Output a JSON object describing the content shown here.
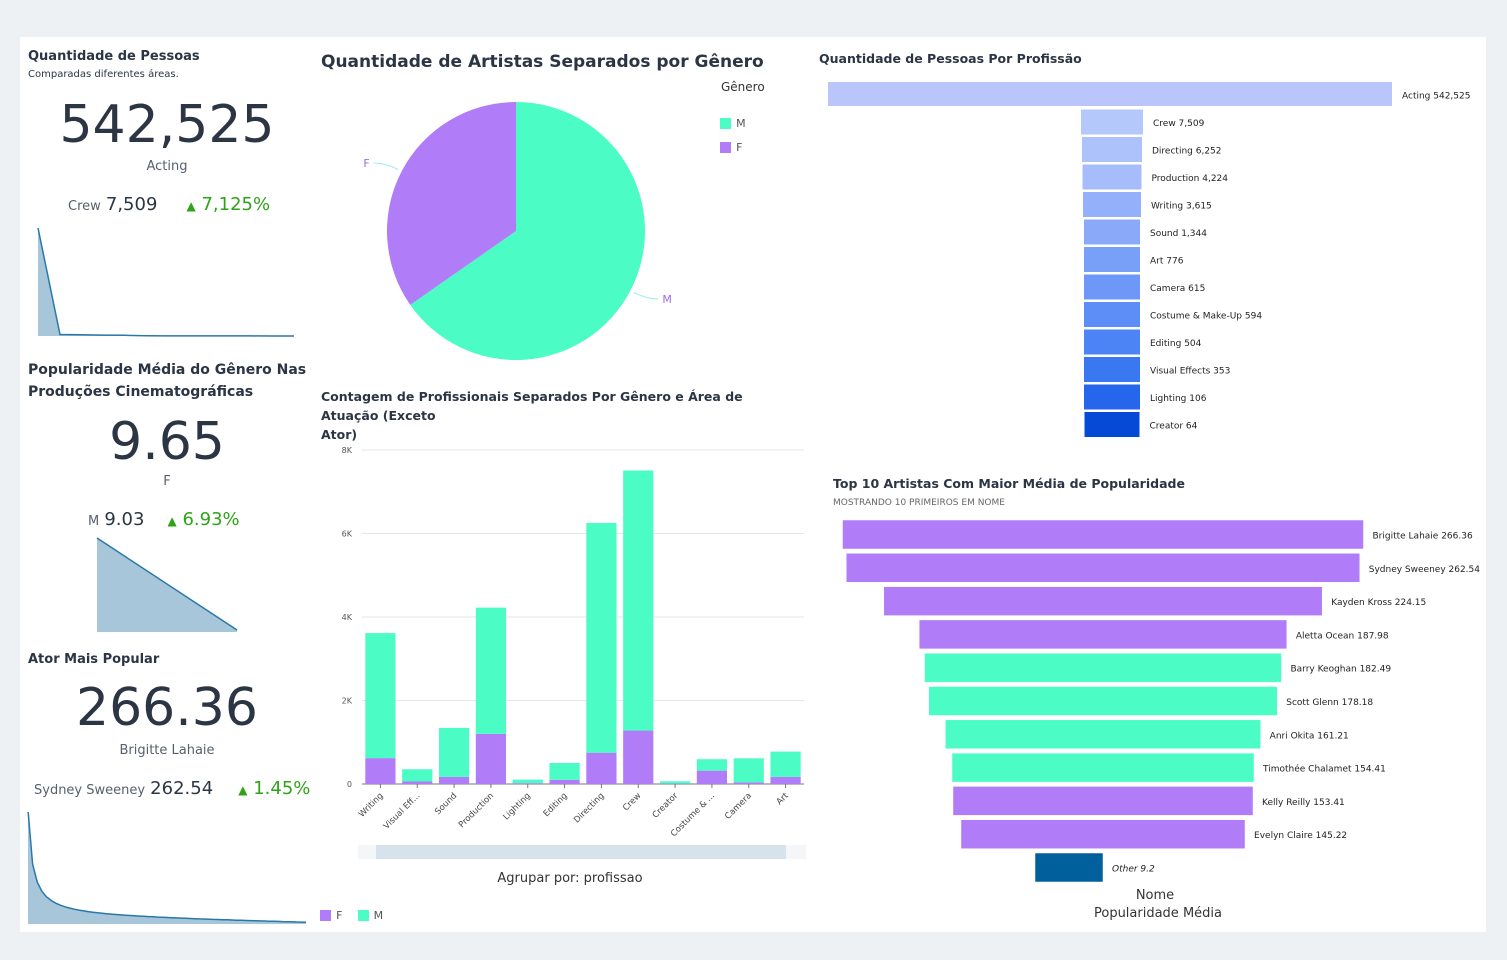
{
  "kpi1": {
    "title": "Quantidade de Pessoas",
    "subtitle": "Comparadas diferentes áreas.",
    "value": "542,525",
    "label": "Acting",
    "compare_label": "Crew",
    "compare_value": "7,509",
    "delta": "7,125%",
    "sparkline": [
      542525,
      7509,
      6252,
      4224,
      3615,
      1344,
      776,
      615,
      594,
      504,
      353,
      106,
      64
    ]
  },
  "kpi2": {
    "title_line1": "Popularidade Média do Gênero Nas",
    "title_line2": "Produções Cinematográficas",
    "value": "9.65",
    "label": "F",
    "compare_label": "M",
    "compare_value": "9.03",
    "delta": "6.93%",
    "sparkline": [
      9.65,
      9.03
    ]
  },
  "kpi3": {
    "title": "Ator Mais Popular",
    "value": "266.36",
    "label": "Brigitte Lahaie",
    "compare_label": "Sydney Sweeney",
    "compare_value": "262.54",
    "delta": "1.45%"
  },
  "colors": {
    "male": "#4cfcc5",
    "female": "#b07cf7",
    "sparkline_fill": "#a7c6da",
    "sparkline_line": "#2a78a8",
    "other_bar": "#00609c"
  },
  "chart_data": [
    {
      "type": "pie",
      "title": "Quantidade de Artistas Separados por Gênero",
      "legend_title": "Gênero",
      "legend_position": "top-right",
      "slices": [
        {
          "label": "M",
          "value": 65.3
        },
        {
          "label": "F",
          "value": 34.7
        }
      ]
    },
    {
      "type": "bar",
      "stacked": true,
      "title_line1": "Contagem de Profissionais Separados Por Gênero e Área de Atuação (Exceto",
      "title_line2": "Ator)",
      "categories": [
        "Writing",
        "Visual Eff...",
        "Sound",
        "Production",
        "Lighting",
        "Editing",
        "Directing",
        "Crew",
        "Creator",
        "Costume & ...",
        "Camera",
        "Art"
      ],
      "series": [
        {
          "name": "F",
          "values": [
            620,
            60,
            170,
            1200,
            20,
            100,
            750,
            1280,
            10,
            320,
            40,
            170
          ]
        },
        {
          "name": "M",
          "values": [
            2995,
            293,
            1174,
            3024,
            86,
            404,
            5502,
            6229,
            54,
            274,
            575,
            606
          ]
        }
      ],
      "yticks": [
        "0",
        "2K",
        "4K",
        "6K",
        "8K"
      ],
      "ylim": [
        0,
        8000
      ],
      "group_by_label": "Agrupar por: profissao",
      "legend_position": "bottom",
      "grid": true
    },
    {
      "type": "bar",
      "orientation": "funnel",
      "title": "Quantidade de Pessoas Por Profissão",
      "categories": [
        "Acting",
        "Crew",
        "Directing",
        "Production",
        "Writing",
        "Sound",
        "Art",
        "Camera",
        "Costume & Make-Up",
        "Editing",
        "Visual Effects",
        "Lighting",
        "Creator"
      ],
      "values": [
        542525,
        7509,
        6252,
        4224,
        3615,
        1344,
        776,
        615,
        594,
        504,
        353,
        106,
        64
      ],
      "labels": [
        "Acting 542,525",
        "Crew 7,509",
        "Directing 6,252",
        "Production 4,224",
        "Writing 3,615",
        "Sound 1,344",
        "Art 776",
        "Camera 615",
        "Costume & Make-Up 594",
        "Editing 504",
        "Visual Effects 353",
        "Lighting 106",
        "Creator 64"
      ],
      "colors": [
        "#bac6fb",
        "#b4c8fb",
        "#adc2fb",
        "#a6bcfb",
        "#95b0fa",
        "#8aaaf9",
        "#79a0f9",
        "#6d98f8",
        "#5d8ef7",
        "#4c84f5",
        "#3a78f2",
        "#2666ed",
        "#054ad6"
      ]
    },
    {
      "type": "bar",
      "orientation": "funnel",
      "title": "Top 10 Artistas Com Maior Média de Popularidade",
      "subtitle": "MOSTRANDO 10 PRIMEIROS EM NOME",
      "categories": [
        "Brigitte Lahaie",
        "Sydney Sweeney",
        "Kayden Kross",
        "Aletta Ocean",
        "Barry Keoghan",
        "Scott Glenn",
        "Anri Okita",
        "Timothée Chalamet",
        "Kelly Reilly",
        "Evelyn Claire",
        "Other"
      ],
      "values": [
        266.36,
        262.54,
        224.15,
        187.98,
        182.49,
        178.18,
        161.21,
        154.41,
        153.41,
        145.22,
        9.2
      ],
      "labels": [
        "Brigitte Lahaie 266.36",
        "Sydney Sweeney 262.54",
        "Kayden Kross 224.15",
        "Aletta Ocean 187.98",
        "Barry Keoghan 182.49",
        "Scott Glenn 178.18",
        "Anri Okita 161.21",
        "Timothée Chalamet 154.41",
        "Kelly Reilly 153.41",
        "Evelyn Claire 145.22",
        "Other 9.2"
      ],
      "genders": [
        "F",
        "F",
        "F",
        "F",
        "M",
        "M",
        "M",
        "M",
        "F",
        "F",
        "other"
      ],
      "xlabel": "Nome",
      "ylabel": "Popularidade Média"
    }
  ]
}
